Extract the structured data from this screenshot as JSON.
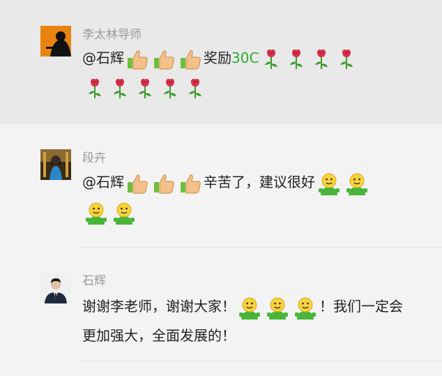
{
  "messages": [
    {
      "name": "李太林导师",
      "mention": "@石辉",
      "after_thumbs": "奖励",
      "reward": "30C"
    },
    {
      "name": "段卉",
      "mention": "@石辉",
      "after_thumbs": "辛苦了，建议很好"
    },
    {
      "name": "石辉",
      "text_line1": "谢谢李老师，谢谢大家！",
      "text_after": "！我们一定会",
      "text_line2": "更加强大，全面发展的！"
    }
  ],
  "icons": {
    "thumb": "thumbs-up-icon",
    "rose": "rose-icon",
    "smile": "green-smiley-icon"
  },
  "colors": {
    "accent_green": "#2aae2a",
    "name_gray": "#9a9a9a",
    "highlight_bg": "#e9e9e9",
    "page_bg": "#f3f3f3"
  }
}
